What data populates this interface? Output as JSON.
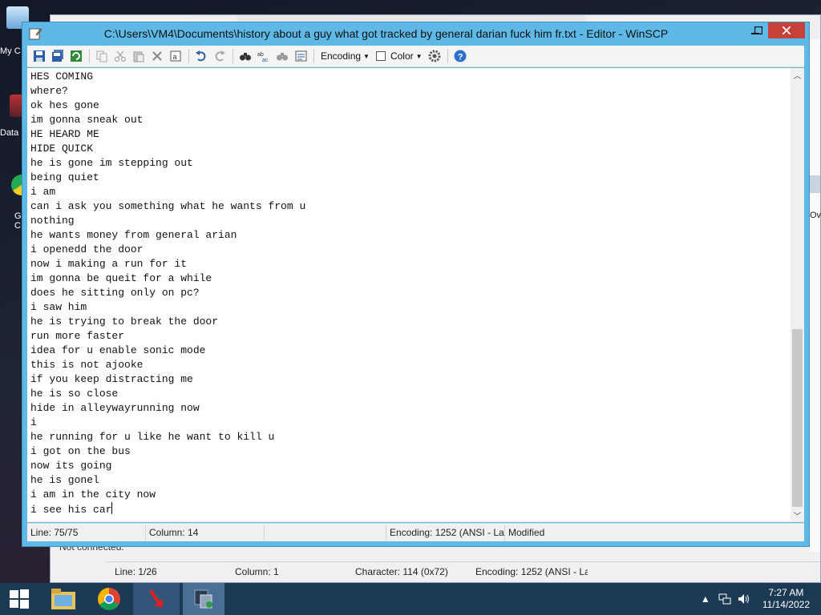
{
  "desktop": {
    "icons": [
      {
        "label": "My C",
        "icon": "computer-icon"
      },
      {
        "label": "Data",
        "icon": "shortcut-icon"
      },
      {
        "label": "G C",
        "icon": "chrome-icon"
      }
    ]
  },
  "background_window": {
    "side_text": "Ov",
    "not_connected": "Not connected.",
    "status": {
      "line": "Line: 1/26",
      "column": "Column: 1",
      "character": "Character: 114 (0x72)",
      "encoding": "Encoding: 1252  (ANSI - La"
    }
  },
  "editor": {
    "title": "C:\\Users\\VM4\\Documents\\history about a guy what got tracked by general darian fuck him fr.txt - Editor - WinSCP",
    "toolbar": {
      "encoding_label": "Encoding",
      "color_label": "Color"
    },
    "lines": [
      "HES COMING",
      "where?",
      "ok hes gone",
      "im gonna sneak out",
      "HE HEARD ME",
      "HIDE QUICK",
      "he is gone im stepping out",
      "being quiet",
      "i am",
      "can i ask you something what he wants from u",
      "nothing",
      "he wants money from general arian",
      "i openedd the door",
      "now i making a run for it",
      "im gonna be queit for a while",
      "does he sitting only on pc?",
      "i saw him",
      "he is trying to break the door",
      "run more faster",
      "idea for u enable sonic mode",
      "this is not ajooke",
      "if you keep distracting me",
      "he is so close",
      "hide in alleywayrunning now",
      "i",
      "he running for u like he want to kill u",
      "i got on the bus",
      "now its going",
      "he is gonel",
      "i am in the city now",
      "i see his car"
    ],
    "status": {
      "line": "Line: 75/75",
      "column": "Column: 14",
      "blank": "",
      "encoding": "Encoding: 1252  (ANSI - La",
      "modified": "Modified"
    }
  },
  "taskbar": {
    "time": "7:27 AM",
    "date": "11/14/2022"
  },
  "colors": {
    "title_bar": "#5fb9e7",
    "close_button": "#c7413b",
    "taskbar": "#1d3a55"
  }
}
